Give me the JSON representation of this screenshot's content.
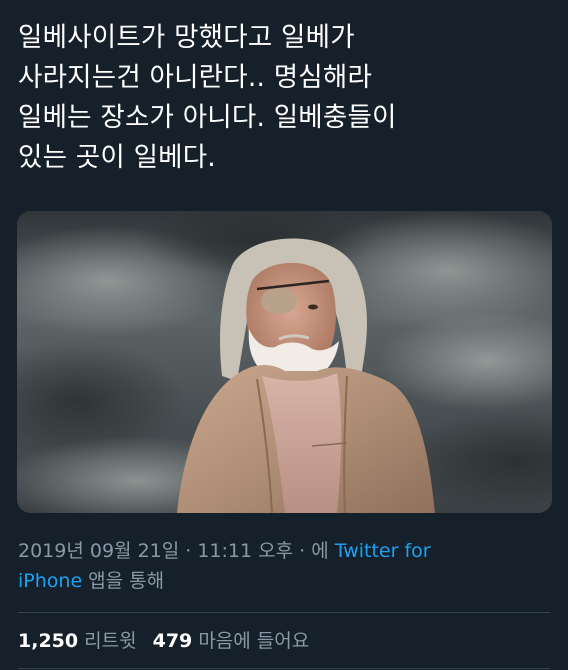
{
  "tweet": {
    "lines": [
      "일베사이트가 망했다고 일베가",
      "사라지는건 아니란다.. 명심해라",
      "일베는 장소가 아니다. 일베충들이",
      "있는 곳이 일베다."
    ]
  },
  "meta": {
    "timestamp": "2019년 09월 21일 · 11:11 오후",
    "separator": " · 에 ",
    "source_line1": "Twitter for",
    "source_line2": "iPhone",
    "suffix": " 앱을 통해"
  },
  "stats": {
    "retweets_count": "1,250",
    "retweets_label": "리트윗",
    "likes_count": "479",
    "likes_label": "마음에 들어요"
  },
  "colors": {
    "background": "#15202b",
    "text": "#ffffff",
    "secondary_text": "#8899a6",
    "link": "#1da1f2",
    "divider": "#38444d"
  }
}
